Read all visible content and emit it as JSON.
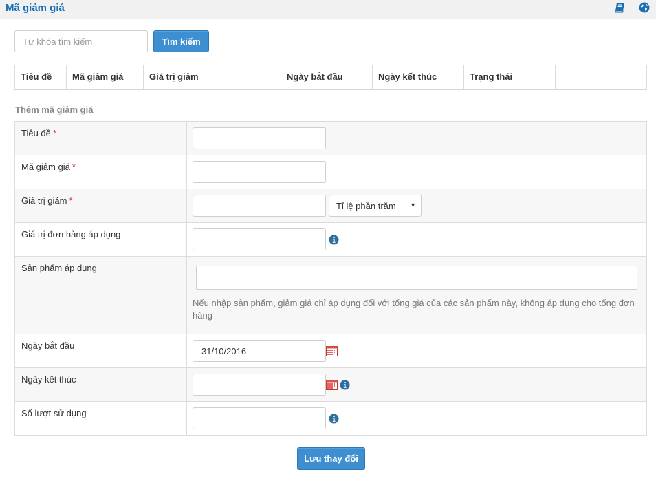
{
  "header": {
    "title": "Mã giảm giá",
    "icons": [
      "book-icon",
      "globe-icon"
    ]
  },
  "search": {
    "placeholder": "Từ khóa tìm kiếm",
    "button_label": "Tìm kiếm"
  },
  "list_table": {
    "columns": [
      "Tiêu đề",
      "Mã giảm giá",
      "Giá trị giảm",
      "Ngày bắt đầu",
      "Ngày kết thúc",
      "Trạng thái",
      ""
    ]
  },
  "form": {
    "section_title": "Thêm mã giảm giá",
    "required_mark": "*",
    "fields": {
      "title": {
        "label": "Tiêu đề",
        "value": ""
      },
      "code": {
        "label": "Mã giảm giá",
        "value": ""
      },
      "discount_value": {
        "label": "Giá trị giảm",
        "value": "",
        "type_selected": "Tỉ lệ phần trăm"
      },
      "order_value": {
        "label": "Giá trị đơn hàng áp dụng",
        "value": ""
      },
      "products": {
        "label": "Sản phẩm áp dụng",
        "value": "",
        "hint": "Nếu nhập sản phẩm, giảm giá chỉ áp dụng đối với tổng giá của các sản phẩm này, không áp dụng cho tổng đơn hàng"
      },
      "start_date": {
        "label": "Ngày bắt đầu",
        "value": "31/10/2016"
      },
      "end_date": {
        "label": "Ngày kết thúc",
        "value": ""
      },
      "usage_count": {
        "label": "Số lượt sử dụng",
        "value": ""
      }
    },
    "save_label": "Lưu thay đổi"
  },
  "colors": {
    "accent": "#1a6fb3",
    "button": "#3d8fd1",
    "required": "#d9312f",
    "info_icon": "#2c6e9e"
  }
}
